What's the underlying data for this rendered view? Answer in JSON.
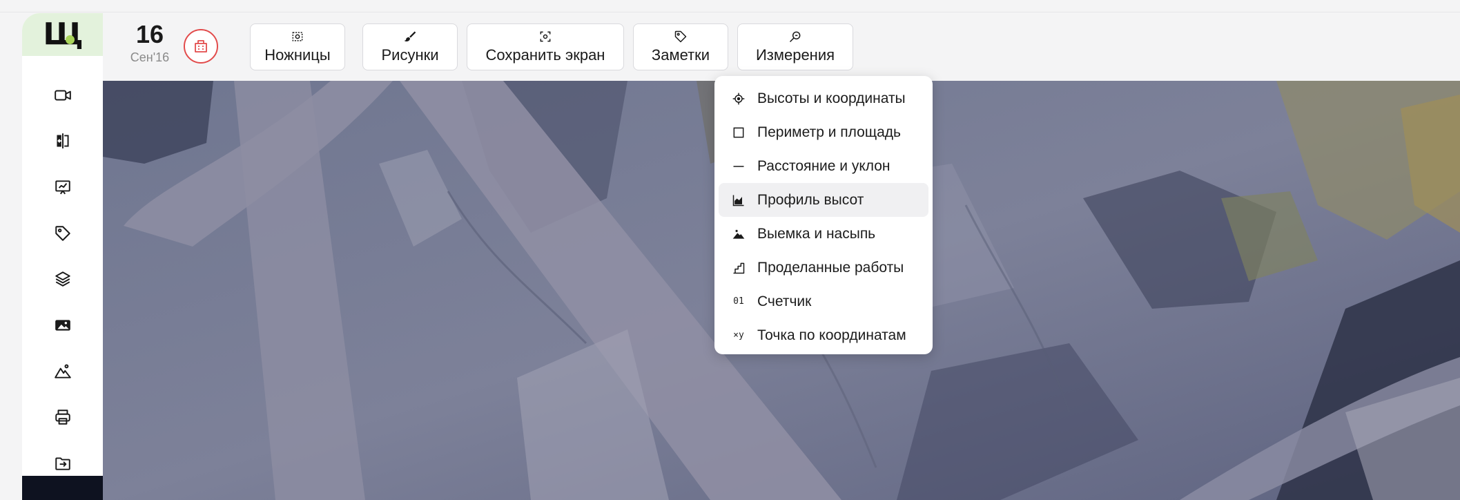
{
  "header": {
    "date_day": "16",
    "date_month": "Сен'16"
  },
  "toolbar": {
    "tools": [
      {
        "label": "Ножницы",
        "icon": "scissors-frame-icon"
      },
      {
        "label": "Рисунки",
        "icon": "brush-icon"
      },
      {
        "label": "Сохранить экран",
        "icon": "screenshot-icon"
      },
      {
        "label": "Заметки",
        "icon": "tag-icon"
      },
      {
        "label": "Измерения",
        "icon": "measure-search-icon"
      }
    ]
  },
  "sidebar": {
    "logo_text": "Щ",
    "items": [
      {
        "icon": "video-camera-icon"
      },
      {
        "icon": "compare-icon"
      },
      {
        "icon": "presentation-chart-icon"
      },
      {
        "icon": "tag-icon"
      },
      {
        "icon": "layers-icon"
      },
      {
        "icon": "image-icon"
      },
      {
        "icon": "mountain-icon"
      },
      {
        "icon": "printer-icon"
      },
      {
        "icon": "folder-import-icon"
      }
    ]
  },
  "measure_menu": {
    "items": [
      {
        "label": "Высоты и координаты",
        "icon": "crosshair-icon"
      },
      {
        "label": "Периметр и площадь",
        "icon": "square-icon"
      },
      {
        "label": "Расстояние и уклон",
        "icon": "line-icon"
      },
      {
        "label": "Профиль высот",
        "icon": "area-chart-icon",
        "active": true
      },
      {
        "label": "Выемка и насыпь",
        "icon": "pile-icon"
      },
      {
        "label": "Проделанные работы",
        "icon": "steps-icon"
      },
      {
        "label": "Счетчик",
        "icon": "counter-icon",
        "glyph": "01"
      },
      {
        "label": "Точка по координатам",
        "icon": "xy-icon",
        "glyph": "×y"
      }
    ]
  },
  "colors": {
    "logo_bg": "#e3f2dc",
    "logo_dot": "#a8d45a",
    "alert": "#e24b4b",
    "sidebar_bottom": "#0e1220"
  }
}
